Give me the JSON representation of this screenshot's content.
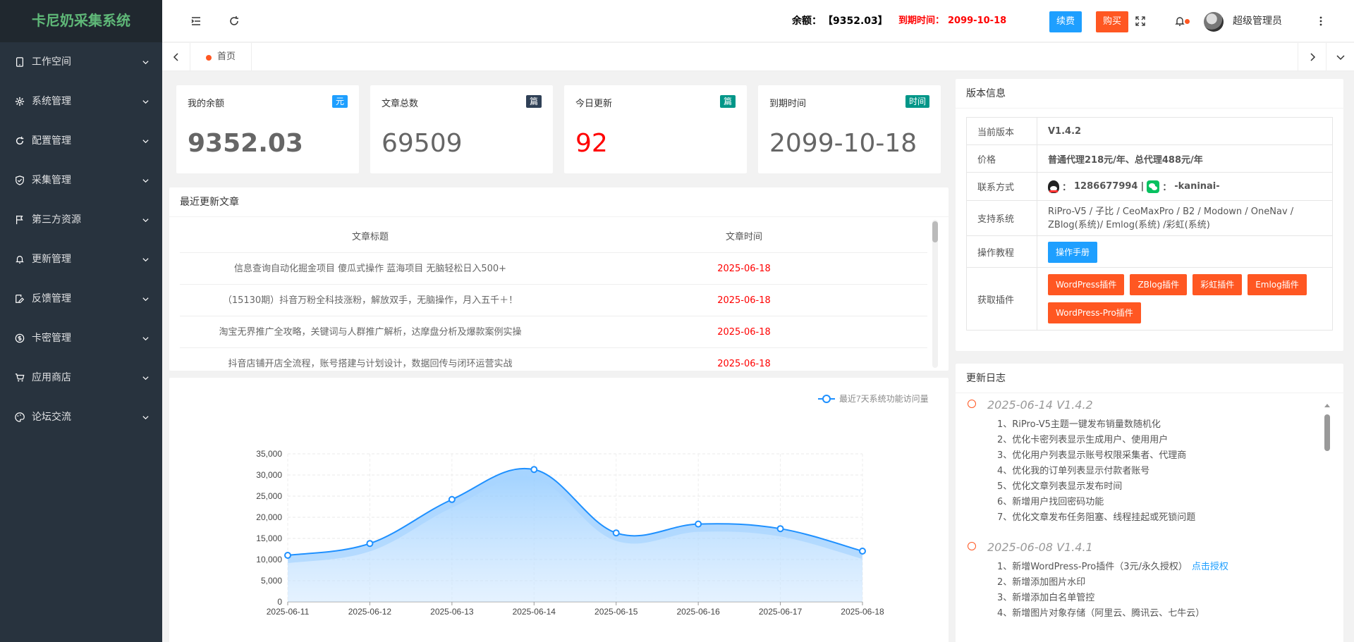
{
  "app": {
    "logo": "卡尼奶采集系统"
  },
  "sidebar": {
    "items": [
      {
        "label": "工作空间",
        "icon": "tablet-icon"
      },
      {
        "label": "系统管理",
        "icon": "gear-icon"
      },
      {
        "label": "配置管理",
        "icon": "refresh-icon"
      },
      {
        "label": "采集管理",
        "icon": "shield-icon"
      },
      {
        "label": "第三方资源",
        "icon": "flag-icon"
      },
      {
        "label": "更新管理",
        "icon": "bell-icon"
      },
      {
        "label": "反馈管理",
        "icon": "edit-icon"
      },
      {
        "label": "卡密管理",
        "icon": "dollar-icon"
      },
      {
        "label": "应用商店",
        "icon": "cart-icon"
      },
      {
        "label": "论坛交流",
        "icon": "palette-icon"
      }
    ]
  },
  "header": {
    "balance_label": "余额：",
    "balance_value": "【9352.03】",
    "expire_label": "到期时间：",
    "expire_value": "2099-10-18",
    "renew_label": "续费",
    "buy_label": "购买",
    "username": "超级管理员"
  },
  "tabs": {
    "home": "首页"
  },
  "stats": [
    {
      "title": "我的余额",
      "badge": "元",
      "badge_color": "#1e9fff",
      "value": "9352.03",
      "value_color": "#666666",
      "bold": true
    },
    {
      "title": "文章总数",
      "badge": "篇",
      "badge_color": "#2f4056",
      "value": "69509",
      "value_color": "#666666",
      "bold": false
    },
    {
      "title": "今日更新",
      "badge": "篇",
      "badge_color": "#009688",
      "value": "92",
      "value_color": "#ff0000",
      "bold": false
    },
    {
      "title": "到期时间",
      "badge": "时间",
      "badge_color": "#009688",
      "value": "2099-10-18",
      "value_color": "#666666",
      "bold": false
    }
  ],
  "articles": {
    "title": "最近更新文章",
    "col_title": "文章标题",
    "col_time": "文章时间",
    "rows": [
      {
        "title": "信息查询自动化掘金项目 傻瓜式操作 蓝海项目 无脑轻松日入500+",
        "time": "2025-06-18"
      },
      {
        "title": "（15130期）抖音万粉全科技涨粉，解放双手，无脑操作，月入五千＋！",
        "time": "2025-06-18"
      },
      {
        "title": "淘宝无界推广全攻略，关键词与人群推广解析，达摩盘分析及爆款案例实操",
        "time": "2025-06-18"
      },
      {
        "title": "抖音店铺开店全流程，账号搭建与计划设计，数据回传与闭环运营实战",
        "time": "2025-06-18"
      }
    ]
  },
  "chart_data": {
    "type": "area",
    "legend": "最近7天系统功能访问量",
    "legend_position": "top-right",
    "categories": [
      "2025-06-11",
      "2025-06-12",
      "2025-06-13",
      "2025-06-14",
      "2025-06-15",
      "2025-06-16",
      "2025-06-17",
      "2025-06-18"
    ],
    "series": [
      {
        "name": "最近7天系统功能访问量",
        "values": [
          11000,
          13800,
          24200,
          31300,
          16300,
          18400,
          17300,
          12000
        ]
      }
    ],
    "ylim": [
      0,
      35000
    ],
    "yticks": [
      "0",
      "5,000",
      "10,000",
      "15,000",
      "20,000",
      "25,000",
      "30,000",
      "35,000"
    ],
    "color": "#1e90ff"
  },
  "version": {
    "title": "版本信息",
    "rows": {
      "current_label": "当前版本",
      "current_value": "V1.4.2",
      "price_label": "价格",
      "price_value": "普通代理218元/年、总代理488元/年",
      "contact_label": "联系方式",
      "qq_value": "1286677994",
      "wechat_value": "-kaninai-",
      "support_label": "支持系统",
      "support_value": "RiPro-V5 / 子比 / CeoMaxPro / B2 / Modown / OneNav / ZBlog(系统)/ Emlog(系统) /彩虹(系统)",
      "tutorial_label": "操作教程",
      "tutorial_button": "操作手册",
      "plugin_label": "获取插件",
      "plugins": [
        "WordPress插件",
        "ZBlog插件",
        "彩虹插件",
        "Emlog插件",
        "WordPress-Pro插件"
      ]
    }
  },
  "changelog": {
    "title": "更新日志",
    "entries": [
      {
        "head": "2025-06-14  V1.4.2",
        "items": [
          "1、RiPro-V5主题一键发布销量数随机化",
          "2、优化卡密列表显示生成用户、使用用户",
          "3、优化用户列表显示账号权限采集者、代理商",
          "4、优化我的订单列表显示付款者账号",
          "5、优化文章列表显示发布时间",
          "6、新增用户找回密码功能",
          "7、优化文章发布任务阻塞、线程挂起或死锁问题"
        ]
      },
      {
        "head": "2025-06-08  V1.4.1",
        "items": [
          "1、新增WordPress-Pro插件（3元/永久授权）",
          "2、新增添加图片水印",
          "3、新增添加白名单管控",
          "4、新增图片对象存储（阿里云、腾讯云、七牛云）"
        ],
        "link": "点击授权"
      }
    ]
  }
}
